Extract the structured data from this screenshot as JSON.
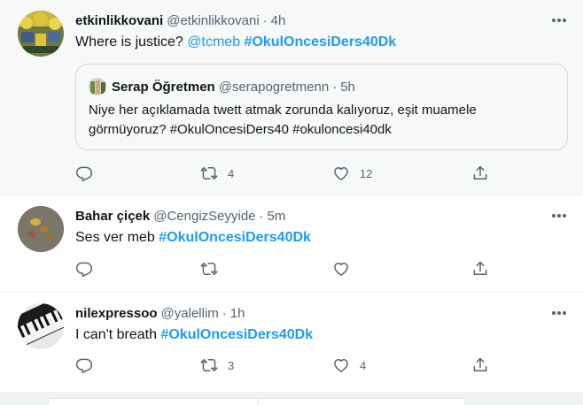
{
  "colors": {
    "accent": "#1d9bf0",
    "secondary_text": "#536471",
    "highlight_bg": "#f7f9f9"
  },
  "tweets": [
    {
      "name": "etkinlikkovani",
      "handle": "@etkinlikkovani",
      "dot": "·",
      "time": "4h",
      "text_plain": "Where is justice?",
      "mention": "@tcmeb",
      "hashtag": "#OkulOncesiDers40Dk",
      "quote": {
        "name": "Serap Öğretmen",
        "handle": "@serapogretmenn",
        "dot": "·",
        "time": "5h",
        "text": "Niye her açıklamada twett atmak zorunda kalıyoruz, eşit muamele görmüyoruz? #OkulOncesiDers40 #okuloncesi40dk"
      },
      "replies": "",
      "retweets": "4",
      "likes": "12"
    },
    {
      "name": "Bahar çiçek",
      "handle": "@CengizSeyyide",
      "dot": "·",
      "time": "5m",
      "text_plain": "Ses ver meb",
      "hashtag": "#OkulOncesiDers40Dk",
      "replies": "",
      "retweets": "",
      "likes": ""
    },
    {
      "name": "nilexpressoo",
      "handle": "@yalellim",
      "dot": "·",
      "time": "1h",
      "text_plain": "I can't breath",
      "hashtag": "#OkulOncesiDers40Dk",
      "replies": "",
      "retweets": "3",
      "likes": "4"
    }
  ],
  "icons": {
    "reply": "reply-icon",
    "retweet": "retweet-icon",
    "like": "heart-icon",
    "share": "share-icon",
    "more": "more-icon"
  }
}
